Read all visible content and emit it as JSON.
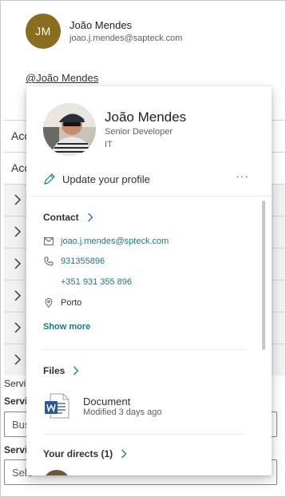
{
  "header": {
    "initials": "JM",
    "name": "João Mendes",
    "email": "joao.j.mendes@sapteck.com",
    "mention": "@João Mendes"
  },
  "background": {
    "rows": [
      "Acc",
      "Acc"
    ],
    "chevron_rows_count": 6,
    "label_1": "Servi",
    "label_2": "Servi",
    "input_1_value": "Bus",
    "label_3": "Servi",
    "input_2_placeholder": "Sele"
  },
  "card": {
    "name": "João Mendes",
    "job_title": "Senior Developer",
    "department": "IT",
    "update_profile": "Update your profile",
    "more": "···",
    "contact": {
      "heading": "Contact",
      "email": "joao.j.mendes@spteck.com",
      "phone": "931355896",
      "mobile": "+351 931 355 896",
      "location": "Porto",
      "show_more": "Show more"
    },
    "files": {
      "heading": "Files",
      "doc_name": "Document",
      "doc_meta": "Modified 3 days ago"
    },
    "directs": {
      "heading": "Your directs (1)"
    }
  },
  "colors": {
    "accent": "#0f7d8a",
    "avatar_bg": "#8a6d1f",
    "word_blue": "#2b579a"
  }
}
